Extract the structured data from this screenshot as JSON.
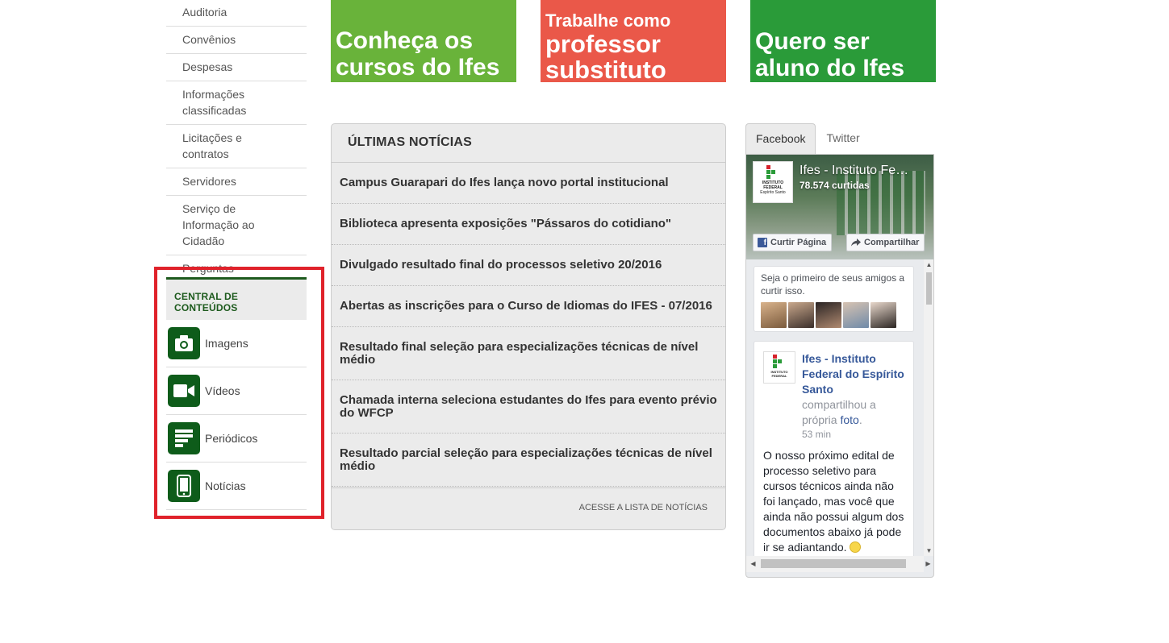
{
  "left_menu": {
    "items": [
      {
        "label": "Auditoria"
      },
      {
        "label": "Convênios"
      },
      {
        "label": "Despesas"
      },
      {
        "label": "Informações classificadas"
      },
      {
        "label": "Licitações e contratos"
      },
      {
        "label": "Servidores"
      },
      {
        "label": "Serviço de Informação ao Cidadão"
      },
      {
        "label": "Perguntas Frequentes"
      }
    ]
  },
  "central": {
    "title": "CENTRAL DE CONTEÚDOS",
    "items": [
      {
        "label": "Imagens",
        "icon": "camera-icon"
      },
      {
        "label": "Vídeos",
        "icon": "video-camera-icon"
      },
      {
        "label": "Periódicos",
        "icon": "document-lines-icon"
      },
      {
        "label": "Notícias",
        "icon": "mobile-phone-icon"
      }
    ]
  },
  "banners": {
    "cursos": "Conheça os cursos do Ifes",
    "professor_small": "Trabalhe como",
    "professor_big": "professor substituto",
    "aluno": "Quero ser aluno do Ifes"
  },
  "news": {
    "title": "ÚLTIMAS NOTÍCIAS",
    "items": [
      "Campus Guarapari do Ifes lança novo portal institucional",
      "Biblioteca apresenta exposições \"Pássaros do cotidiano\"",
      "Divulgado resultado final do processos seletivo 20/2016",
      "Abertas as inscrições para o Curso de Idiomas do IFES - 07/2016",
      "Resultado final seleção para especializações técnicas de nível médio",
      "Chamada interna seleciona estudantes do Ifes para evento prévio do WFCP",
      "Resultado parcial seleção para especializações técnicas de nível médio"
    ],
    "footer_link": "ACESSE A LISTA DE NOTÍCIAS"
  },
  "social": {
    "tabs": [
      "Facebook",
      "Twitter"
    ],
    "active_tab": "Facebook",
    "page_name": "Ifes - Instituto Federal do Espírito Santo",
    "likes": "78.574 curtidas",
    "like_button": "Curtir Página",
    "share_button": "Compartilhar",
    "friends_text": "Seja o primeiro de seus amigos a curtir isso.",
    "logo_text": "INSTITUTO FEDERAL",
    "logo_subtext": "Espírito Santo",
    "post": {
      "author": "Ifes - Instituto Federal do Espírito Santo",
      "action_prefix": "compartilhou a própria",
      "action_link": "foto",
      "time": "53 min",
      "text": "O nosso próximo edital de processo seletivo para cursos técnicos ainda não foi lançado, mas você que ainda não possui algum dos documentos abaixo já pode ir se adiantando."
    }
  },
  "colors": {
    "highlight": "#e0222b",
    "ifes_green": "#0e5c1a",
    "banner_green_light": "#69b33a",
    "banner_red": "#ea5849",
    "banner_green": "#2a9b39",
    "fb_link": "#365899"
  }
}
